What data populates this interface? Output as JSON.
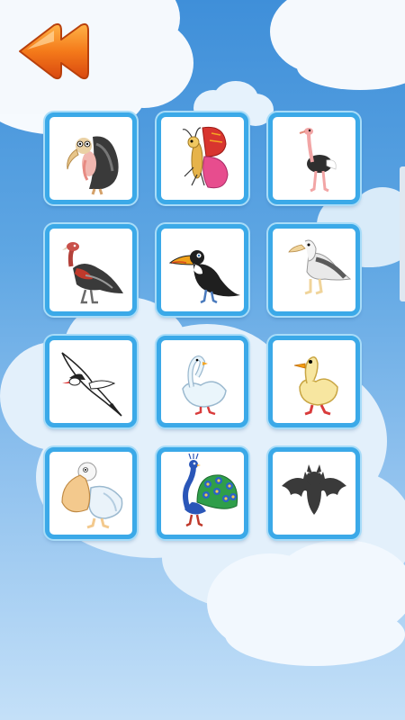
{
  "screen": {
    "colors": {
      "sky_top": "#3f8fd9",
      "sky_bottom": "#c4e0f8",
      "tile_border": "#3ba9e8",
      "back_button": "#f06a12"
    }
  },
  "back_button": {
    "icon": "double-chevron-left-icon"
  },
  "birds": [
    {
      "id": "vulture",
      "icon": "vulture-icon",
      "locked": false
    },
    {
      "id": "butterfly",
      "icon": "butterfly-icon",
      "locked": false
    },
    {
      "id": "ostrich",
      "icon": "ostrich-icon",
      "locked": false
    },
    {
      "id": "condor",
      "icon": "condor-icon",
      "locked": false
    },
    {
      "id": "toucan",
      "icon": "toucan-icon",
      "locked": false
    },
    {
      "id": "albatross",
      "icon": "albatross-icon",
      "locked": false
    },
    {
      "id": "seagull",
      "icon": "seagull-icon",
      "locked": false
    },
    {
      "id": "swan",
      "icon": "swan-icon",
      "locked": false
    },
    {
      "id": "duck",
      "icon": "duck-icon",
      "locked": false
    },
    {
      "id": "pelican",
      "icon": "pelican-icon",
      "locked": false
    },
    {
      "id": "peacock",
      "icon": "peacock-icon",
      "locked": false
    },
    {
      "id": "bat",
      "icon": "bat-silhouette-icon",
      "locked": true
    }
  ]
}
